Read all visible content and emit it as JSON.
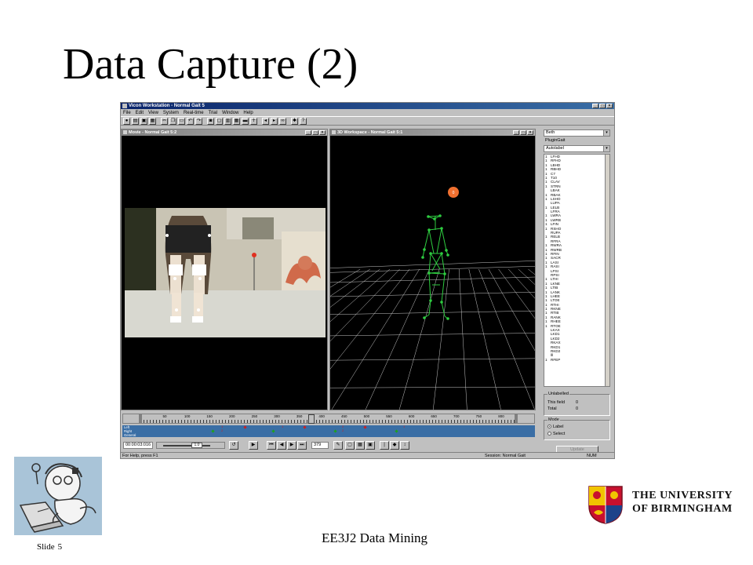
{
  "slide": {
    "title": "Data Capture (2)",
    "slide_label": "Slide",
    "slide_number": "5",
    "footer": "EE3J2 Data Mining",
    "university_line1": "THE UNIVERSITY",
    "university_line2": "OF BIRMINGHAM"
  },
  "app": {
    "window_title": "Vicon Workstation - Normal Gait 5",
    "menu": [
      "File",
      "Edit",
      "View",
      "System",
      "Real-time",
      "Trial",
      "Window",
      "Help"
    ],
    "movie_title": "Movie - Normal Gait 5:2",
    "workspace_title": "3D Workspace - Normal Gait 5:1",
    "subject": "Beth",
    "model": "PluginGait",
    "autolabel": "Autolabel",
    "markers": [
      {
        "n": "1",
        "name": "LFHD"
      },
      {
        "n": "1",
        "name": "RFHD"
      },
      {
        "n": "1",
        "name": "LBHD"
      },
      {
        "n": "1",
        "name": "RBHD"
      },
      {
        "n": "1",
        "name": "C7"
      },
      {
        "n": "1",
        "name": "T10"
      },
      {
        "n": "1",
        "name": "CLAV"
      },
      {
        "n": "1",
        "name": "STRN"
      },
      {
        "n": "",
        "name": "LBAK"
      },
      {
        "n": "1",
        "name": "RBAK"
      },
      {
        "n": "1",
        "name": "LSHO"
      },
      {
        "n": "",
        "name": "LUPA"
      },
      {
        "n": "1",
        "name": "LELB"
      },
      {
        "n": "",
        "name": "LFRA"
      },
      {
        "n": "1",
        "name": "LWRA"
      },
      {
        "n": "1",
        "name": "LWRB"
      },
      {
        "n": "1",
        "name": "LFIN"
      },
      {
        "n": "1",
        "name": "RSHO"
      },
      {
        "n": "",
        "name": "RUPA"
      },
      {
        "n": "1",
        "name": "RELB"
      },
      {
        "n": "",
        "name": "RFRA"
      },
      {
        "n": "1",
        "name": "RWRA"
      },
      {
        "n": "1",
        "name": "RWRB"
      },
      {
        "n": "1",
        "name": "RFIN"
      },
      {
        "n": "1",
        "name": "SACR"
      },
      {
        "n": "1",
        "name": "LASI"
      },
      {
        "n": "1",
        "name": "RASI"
      },
      {
        "n": "",
        "name": "LPSI"
      },
      {
        "n": "",
        "name": "RPSI"
      },
      {
        "n": "1",
        "name": "LTHI"
      },
      {
        "n": "1",
        "name": "LKNE"
      },
      {
        "n": "1",
        "name": "LTIB"
      },
      {
        "n": "1",
        "name": "LANK"
      },
      {
        "n": "1",
        "name": "LHEE"
      },
      {
        "n": "1",
        "name": "LTOE"
      },
      {
        "n": "1",
        "name": "RTHI"
      },
      {
        "n": "1",
        "name": "RKNE"
      },
      {
        "n": "1",
        "name": "RTIB"
      },
      {
        "n": "1",
        "name": "RANK"
      },
      {
        "n": "1",
        "name": "RHEE"
      },
      {
        "n": "1",
        "name": "RTOE"
      },
      {
        "n": "",
        "name": "LKAX"
      },
      {
        "n": "",
        "name": "LKD1"
      },
      {
        "n": "",
        "name": "LKD2"
      },
      {
        "n": "",
        "name": "RKAX"
      },
      {
        "n": "",
        "name": "RKD1"
      },
      {
        "n": "",
        "name": "RKD2"
      },
      {
        "n": "",
        "name": "lll"
      },
      {
        "n": "1",
        "name": "RFEP"
      }
    ],
    "unlabelled": {
      "title": "Unlabelled",
      "this_field_label": "This field",
      "this_field_value": "0",
      "total_label": "Total",
      "total_value": "0"
    },
    "mode": {
      "title": "Mode",
      "label_option": "Label",
      "select_option": "Select",
      "selected": "Label"
    },
    "update_button": "Update",
    "timeline": {
      "ticks": [
        "50",
        "100",
        "150",
        "200",
        "250",
        "300",
        "350",
        "400",
        "450",
        "500",
        "550",
        "600",
        "650",
        "700",
        "750",
        "800"
      ],
      "tracks": [
        "Left",
        "Right",
        "General"
      ],
      "event_markers": [
        "1",
        "1",
        "2",
        "1",
        "2",
        "2"
      ],
      "current_time": "00:00:03:016",
      "speed": "1.0",
      "frame": "379"
    },
    "status": {
      "help": "For Help, press F1",
      "session": "Session:  Normal Gait",
      "num": "NUM"
    },
    "colors": {
      "skeleton": "#2ecc40",
      "grid": "#c8c8c8",
      "title_bar": "#0a246a",
      "track_bg": "#3a6ea5",
      "event_red": "#cc2020",
      "event_green": "#20a020",
      "marker_orange": "#f07030"
    }
  }
}
